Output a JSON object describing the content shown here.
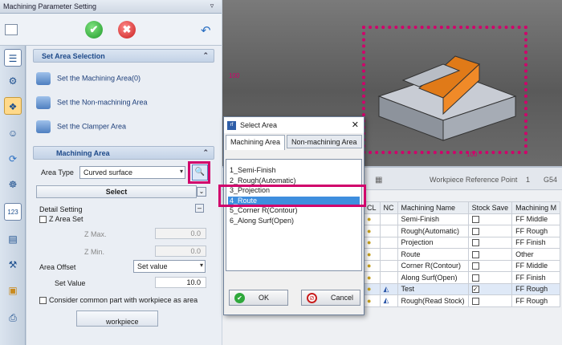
{
  "panel": {
    "title": "Machining Parameter Setting",
    "pin": "▿"
  },
  "area_section": {
    "title": "Set Area Selection",
    "items": [
      "Set the Machining Area(0)",
      "Set the Non-machining Area",
      "Set the Clamper Area"
    ]
  },
  "machining_area": {
    "title": "Machining Area",
    "area_type_label": "Area Type",
    "area_type_value": "Curved surface",
    "select_label": "Select"
  },
  "detail": {
    "title": "Detail Setting",
    "z_area_set": "Z Area Set",
    "z_max_label": "Z Max.",
    "z_max_value": "0.0",
    "z_min_label": "Z Min.",
    "z_min_value": "0.0",
    "area_offset_label": "Area Offset",
    "area_offset_value": "Set value",
    "set_value_label": "Set Value",
    "set_value_value": "10.0",
    "consider_label": "Consider common part with workpiece as area",
    "workpiece_button": "workpiece"
  },
  "view3d": {
    "axis_label_1": "100",
    "axis_label_2": "100"
  },
  "bottom": {
    "toolbar_text": "Workpiece Reference Point",
    "toolbar_num": "1",
    "toolbar_right": "G54",
    "columns": [
      "CL",
      "NC",
      "Machining Name",
      "Stock Save",
      "Machining M"
    ],
    "rows": [
      {
        "name": "Semi-Finish",
        "stock": false,
        "method": "FF Middle"
      },
      {
        "name": "Rough(Automatic)",
        "stock": false,
        "method": "FF Rough"
      },
      {
        "name": "Projection",
        "stock": false,
        "method": "FF Finish"
      },
      {
        "name": "Route",
        "stock": false,
        "method": "Other"
      },
      {
        "name": "Corner R(Contour)",
        "stock": false,
        "method": "FF Middle"
      },
      {
        "name": "Along Surf(Open)",
        "stock": false,
        "method": "FF Finish"
      },
      {
        "name": "Test",
        "stock": true,
        "method": "FF Rough"
      },
      {
        "name": "Rough(Read Stock)",
        "stock": false,
        "method": "FF Rough"
      }
    ]
  },
  "dialog": {
    "title": "Select Area",
    "logo": "rf",
    "close": "✕",
    "tab_machining": "Machining Area",
    "tab_non": "Non-machining Area",
    "list": [
      "1_Semi-Finish",
      "2_Rough(Automatic)",
      "3_Projection",
      "4_Route",
      "5_Corner R(Contour)",
      "6_Along Surf(Open)"
    ],
    "selected_index": 3,
    "ok": "OK",
    "cancel": "Cancel"
  },
  "colors": {
    "highlight": "#d1006b",
    "selection": "#3e8ede"
  },
  "icons": [
    "ok-icon",
    "cancel-icon",
    "undo-icon",
    "search-icon",
    "chevron-icon",
    "clamp-icon"
  ]
}
